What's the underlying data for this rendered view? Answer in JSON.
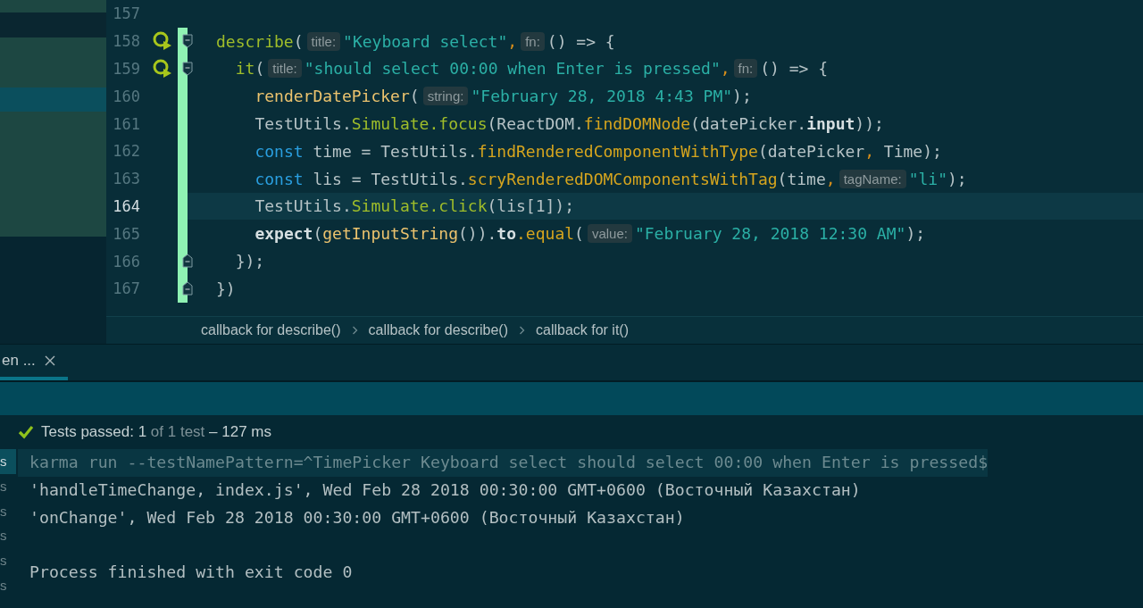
{
  "editor": {
    "lines": [
      {
        "number": "157",
        "current": false,
        "changed": false
      },
      {
        "number": "158",
        "current": false,
        "changed": true,
        "run_icon": true,
        "fold_start": true,
        "tokens": [
          {
            "kind": "call",
            "text": "describe"
          },
          {
            "kind": "plain",
            "text": "("
          },
          {
            "kind": "hint",
            "text": "title:"
          },
          {
            "kind": "str",
            "text": "\"Keyboard select\""
          },
          {
            "kind": "comma",
            "text": ","
          },
          {
            "kind": "hint",
            "text": "fn:"
          },
          {
            "kind": "plain",
            "text": "() => {"
          }
        ],
        "children": [
          {
            "number": "159",
            "current": false,
            "changed": true,
            "run_icon": true,
            "fold_start": true,
            "tokens": [
              {
                "kind": "call",
                "text": "it"
              },
              {
                "kind": "plain",
                "text": "("
              },
              {
                "kind": "hint",
                "text": "title:"
              },
              {
                "kind": "str",
                "text": "\"should select 00:00 when Enter is pressed\""
              },
              {
                "kind": "comma",
                "text": ","
              },
              {
                "kind": "hint",
                "text": "fn:"
              },
              {
                "kind": "plain",
                "text": "() => {"
              }
            ],
            "children": [
              {
                "number": "160",
                "current": false,
                "changed": true,
                "tokens": [
                  {
                    "kind": "fn",
                    "text": "renderDatePicker"
                  },
                  {
                    "kind": "plain",
                    "text": "("
                  },
                  {
                    "kind": "hint",
                    "text": "string:"
                  },
                  {
                    "kind": "str",
                    "text": "\"February 28, 2018 4:43 PM\""
                  },
                  {
                    "kind": "plain",
                    "text": ");"
                  }
                ]
              },
              {
                "number": "161",
                "current": false,
                "changed": true,
                "tokens": [
                  {
                    "kind": "plain",
                    "text": "TestUtils."
                  },
                  {
                    "kind": "call",
                    "text": "Simulate.focus"
                  },
                  {
                    "kind": "plain",
                    "text": "(ReactDOM."
                  },
                  {
                    "kind": "method",
                    "text": "findDOMNode"
                  },
                  {
                    "kind": "plain",
                    "text": "(datePicker."
                  },
                  {
                    "kind": "bold",
                    "text": "input"
                  },
                  {
                    "kind": "plain",
                    "text": "));"
                  }
                ]
              },
              {
                "number": "162",
                "current": false,
                "changed": true,
                "tokens": [
                  {
                    "kind": "kw",
                    "text": "const"
                  },
                  {
                    "kind": "plain",
                    "text": " time = TestUtils."
                  },
                  {
                    "kind": "method",
                    "text": "findRenderedComponentWithType"
                  },
                  {
                    "kind": "plain",
                    "text": "(datePicker"
                  },
                  {
                    "kind": "comma",
                    "text": ","
                  },
                  {
                    "kind": "plain",
                    "text": " Time);"
                  }
                ]
              },
              {
                "number": "163",
                "current": false,
                "changed": true,
                "tokens": [
                  {
                    "kind": "kw",
                    "text": "const"
                  },
                  {
                    "kind": "plain",
                    "text": " lis = TestUtils."
                  },
                  {
                    "kind": "method",
                    "text": "scryRenderedDOMComponentsWithTag"
                  },
                  {
                    "kind": "plain",
                    "text": "(time"
                  },
                  {
                    "kind": "comma",
                    "text": ","
                  },
                  {
                    "kind": "hint",
                    "text": "tagName:"
                  },
                  {
                    "kind": "str",
                    "text": "\"li\""
                  },
                  {
                    "kind": "plain",
                    "text": ");"
                  }
                ]
              },
              {
                "number": "164",
                "current": true,
                "changed": true,
                "tokens": [
                  {
                    "kind": "plain",
                    "text": "TestUtils."
                  },
                  {
                    "kind": "call",
                    "text": "Simulate.click"
                  },
                  {
                    "kind": "plain",
                    "text": "(lis[1]);"
                  }
                ]
              },
              {
                "number": "165",
                "current": false,
                "changed": true,
                "tokens": [
                  {
                    "kind": "bold",
                    "text": "expect"
                  },
                  {
                    "kind": "plain",
                    "text": "("
                  },
                  {
                    "kind": "fn",
                    "text": "getInputString"
                  },
                  {
                    "kind": "plain",
                    "text": "())."
                  },
                  {
                    "kind": "bold",
                    "text": "to"
                  },
                  {
                    "kind": "method",
                    "text": ".equal"
                  },
                  {
                    "kind": "plain",
                    "text": "("
                  },
                  {
                    "kind": "hint",
                    "text": "value:"
                  },
                  {
                    "kind": "str",
                    "text": "\"February 28, 2018 12:30 AM\""
                  },
                  {
                    "kind": "plain",
                    "text": ");"
                  }
                ]
              }
            ]
          },
          {
            "number": "166",
            "current": false,
            "changed": true,
            "fold_end": true,
            "tokens": [
              {
                "kind": "plain",
                "text": "});"
              }
            ]
          }
        ]
      },
      {
        "number": "167",
        "current": false,
        "changed": true,
        "fold_end": true,
        "tokens": [
          {
            "kind": "plain",
            "text": "})"
          }
        ]
      }
    ],
    "breadcrumbs": [
      "callback for describe()",
      "callback for describe()",
      "callback for it()"
    ]
  },
  "run_panel": {
    "tabs": [
      {
        "label": "en ...",
        "selected": true
      }
    ],
    "status": {
      "label": "Tests passed:",
      "count": "1",
      "total": "of 1 test",
      "duration": "– 127 ms"
    },
    "tree_items": [
      {
        "text": "s",
        "selected": true
      },
      {
        "text": "s",
        "selected": false
      },
      {
        "text": "s",
        "selected": false
      },
      {
        "text": "s",
        "selected": false
      },
      {
        "text": "s",
        "selected": false
      },
      {
        "text": "s",
        "selected": false
      }
    ],
    "output": [
      {
        "kind": "command",
        "text": "karma run --testNamePattern=^TimePicker Keyboard select should select 00:00 when Enter is pressed$"
      },
      {
        "kind": "output",
        "text": "'handleTimeChange, index.js', Wed Feb 28 2018 00:30:00 GMT+0600 (Восточный Казахстан)"
      },
      {
        "kind": "output",
        "text": "'onChange', Wed Feb 28 2018 00:30:00 GMT+0600 (Восточный Казахстан)"
      },
      {
        "kind": "blank"
      },
      {
        "kind": "output",
        "text": "Process finished with exit code 0"
      }
    ]
  }
}
